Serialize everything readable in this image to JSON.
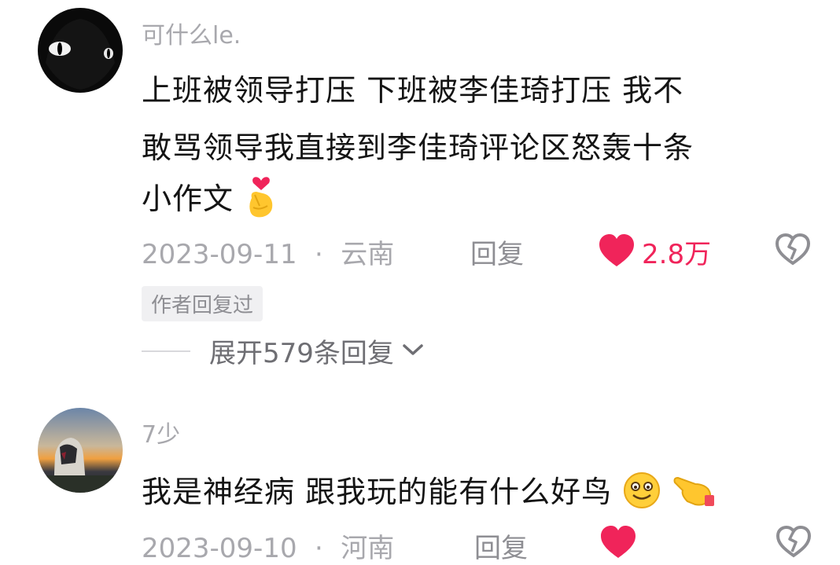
{
  "comments": [
    {
      "username": "可什么le.",
      "lines": [
        "上班被领导打压  下班被李佳琦打压  我不",
        "敢骂领导我直接到李佳琦评论区怒轰十条",
        "小作文"
      ],
      "emoji": "finger-heart-emoji",
      "date": "2023-09-11",
      "separator": "·",
      "location": "云南",
      "reply_label": "回复",
      "like_count": "2.8万",
      "author_tag": "作者回复过",
      "expand_label": "展开579条回复"
    },
    {
      "username": "7少",
      "text": "我是神经病 跟我玩的能有什么好鸟",
      "emojis": [
        "smile-emoji",
        "pointing-hand-emoji"
      ],
      "date": "2023-09-10",
      "separator": "·",
      "location": "河南",
      "reply_label": "回复"
    }
  ],
  "icons": [
    "heart-icon",
    "broken-heart-icon",
    "chevron-down-icon"
  ],
  "colors": {
    "like": "#f0245a",
    "meta": "#a8a8ad",
    "text": "#141414"
  }
}
